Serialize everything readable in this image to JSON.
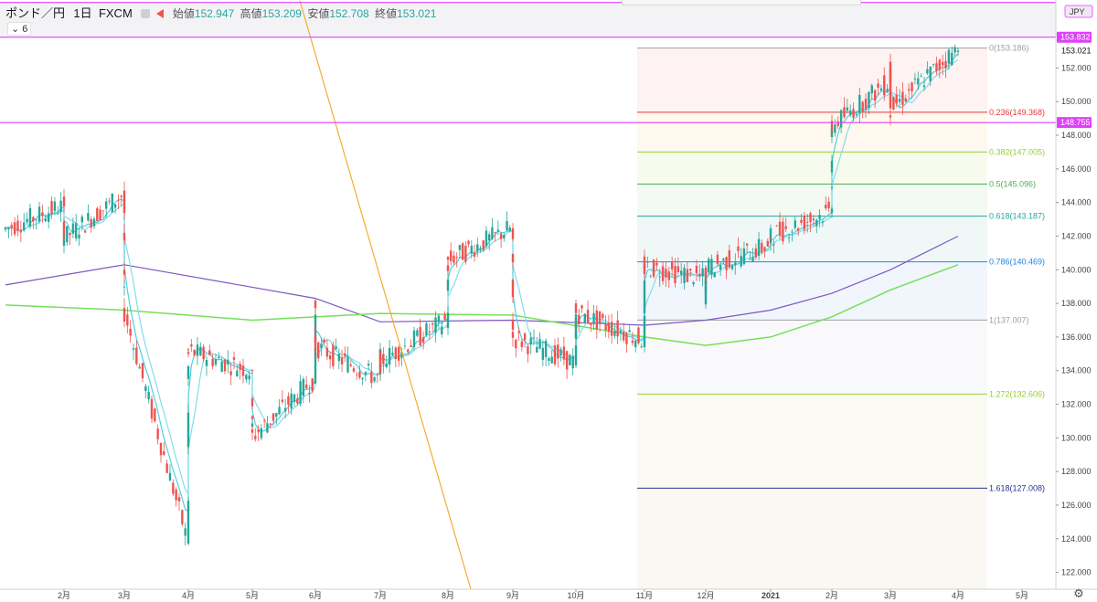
{
  "header": {
    "symbol": "ポンド／円",
    "interval": "1日",
    "source": "FXCM",
    "open_label": "始値",
    "open": "152.947",
    "high_label": "高値",
    "high": "153.209",
    "low_label": "安値",
    "low": "152.708",
    "close_label": "終値",
    "close": "153.021",
    "indicators_toggle": "6",
    "currency": "JPY"
  },
  "colors": {
    "up": "#26a69a",
    "down": "#ef5350",
    "ma_fast": "#4dd0e1",
    "ma_mid": "#80deea",
    "ma_200": "#7e57c2",
    "ma_300": "#76e05a",
    "trendline": "#f5a623",
    "h_lines": "#e040fb"
  },
  "chart_data": {
    "type": "candlestick",
    "x_axis_labels": [
      "2月",
      "3月",
      "4月",
      "5月",
      "6月",
      "7月",
      "8月",
      "9月",
      "10月",
      "11月",
      "12月",
      "2021",
      "2月",
      "3月",
      "4月",
      "5月"
    ],
    "y_axis": {
      "ticks": [
        122.0,
        124.0,
        126.0,
        128.0,
        130.0,
        132.0,
        134.0,
        136.0,
        138.0,
        140.0,
        142.0,
        144.0,
        146.0,
        148.0,
        150.0,
        152.0
      ],
      "ylim": [
        121.0,
        155.5
      ],
      "current_price": 153.021
    },
    "horizontal_lines": [
      {
        "value": 153.832,
        "label": "153.832"
      },
      {
        "value": 148.755,
        "label": "148.755"
      },
      {
        "value": 155.9,
        "label": ""
      }
    ],
    "fibonacci": {
      "start_month": "11月",
      "levels": [
        {
          "ratio": "0",
          "value": 153.186,
          "label": "0(153.186)",
          "color": "#9e9e9e"
        },
        {
          "ratio": "0.236",
          "value": 149.368,
          "label": "0.236(149.368)",
          "color": "#e53935"
        },
        {
          "ratio": "0.382",
          "value": 147.005,
          "label": "0.382(147.005)",
          "color": "#9acd32"
        },
        {
          "ratio": "0.5",
          "value": 145.096,
          "label": "0.5(145.096)",
          "color": "#4caf50"
        },
        {
          "ratio": "0.618",
          "value": 143.187,
          "label": "0.618(143.187)",
          "color": "#26a69a"
        },
        {
          "ratio": "0.786",
          "value": 140.469,
          "label": "0.786(140.469)",
          "color": "#1e88e5"
        },
        {
          "ratio": "1",
          "value": 137.007,
          "label": "1(137.007)",
          "color": "#9e9e9e"
        },
        {
          "ratio": "1.272",
          "value": 132.606,
          "label": "1.272(132.606)",
          "color": "#9acd32"
        },
        {
          "ratio": "1.618",
          "value": 127.008,
          "label": "1.618(127.008)",
          "color": "#283593"
        }
      ]
    },
    "price_path": [
      [
        "1月",
        142.4
      ],
      [
        "2月",
        143.8
      ],
      [
        "2月",
        141.8
      ],
      [
        "3月",
        144.5
      ],
      [
        "3月",
        140.0
      ],
      [
        "3月",
        137.8
      ],
      [
        "4月",
        124.0
      ],
      [
        "4月",
        133.8
      ],
      [
        "4月",
        135.2
      ],
      [
        "5月",
        134.0
      ],
      [
        "5月",
        131.8
      ],
      [
        "5月",
        130.0
      ],
      [
        "6月",
        133.5
      ],
      [
        "6月",
        138.5
      ],
      [
        "6月",
        135.5
      ],
      [
        "7月",
        133.5
      ],
      [
        "7月",
        134.8
      ],
      [
        "7月",
        134.5
      ],
      [
        "8月",
        137.0
      ],
      [
        "8月",
        139.8
      ],
      [
        "8月",
        140.5
      ],
      [
        "9月",
        142.5
      ],
      [
        "9月",
        139.0
      ],
      [
        "9月",
        136.0
      ],
      [
        "10月",
        134.5
      ],
      [
        "10月",
        136.5
      ],
      [
        "10月",
        137.5
      ],
      [
        "11月",
        135.8
      ],
      [
        "11月",
        139.8
      ],
      [
        "11月",
        140.2
      ],
      [
        "12月",
        139.5
      ],
      [
        "12月",
        138.5
      ],
      [
        "12月",
        140.0
      ],
      [
        "2021",
        141.5
      ],
      [
        "2021",
        142.0
      ],
      [
        "2月",
        143.5
      ],
      [
        "2月",
        146.0
      ],
      [
        "2月",
        148.5
      ],
      [
        "3月",
        151.2
      ],
      [
        "3月",
        152.2
      ],
      [
        "3月",
        149.5
      ],
      [
        "4月",
        153.1
      ]
    ],
    "moving_averages": [
      {
        "name": "ma_200",
        "points": [
          [
            "1月",
            139.1
          ],
          [
            "3月",
            140.3
          ],
          [
            "6月",
            138.3
          ],
          [
            "7月",
            136.9
          ],
          [
            "9月",
            137.0
          ],
          [
            "11月",
            136.7
          ],
          [
            "12月",
            137.0
          ],
          [
            "2021",
            137.6
          ],
          [
            "2月",
            138.6
          ],
          [
            "3月",
            140.0
          ],
          [
            "4月",
            142.0
          ]
        ]
      },
      {
        "name": "ma_300",
        "points": [
          [
            "1月",
            137.9
          ],
          [
            "3月",
            137.6
          ],
          [
            "5月",
            137.0
          ],
          [
            "7月",
            137.4
          ],
          [
            "9月",
            137.3
          ],
          [
            "11月",
            136.0
          ],
          [
            "12月",
            135.5
          ],
          [
            "2021",
            136.0
          ],
          [
            "2月",
            137.2
          ],
          [
            "3月",
            138.8
          ],
          [
            "4月",
            140.3
          ]
        ]
      }
    ],
    "trendline": {
      "from": [
        "8月",
        121.0
      ],
      "to": [
        "5月",
        156.0
      ]
    }
  }
}
